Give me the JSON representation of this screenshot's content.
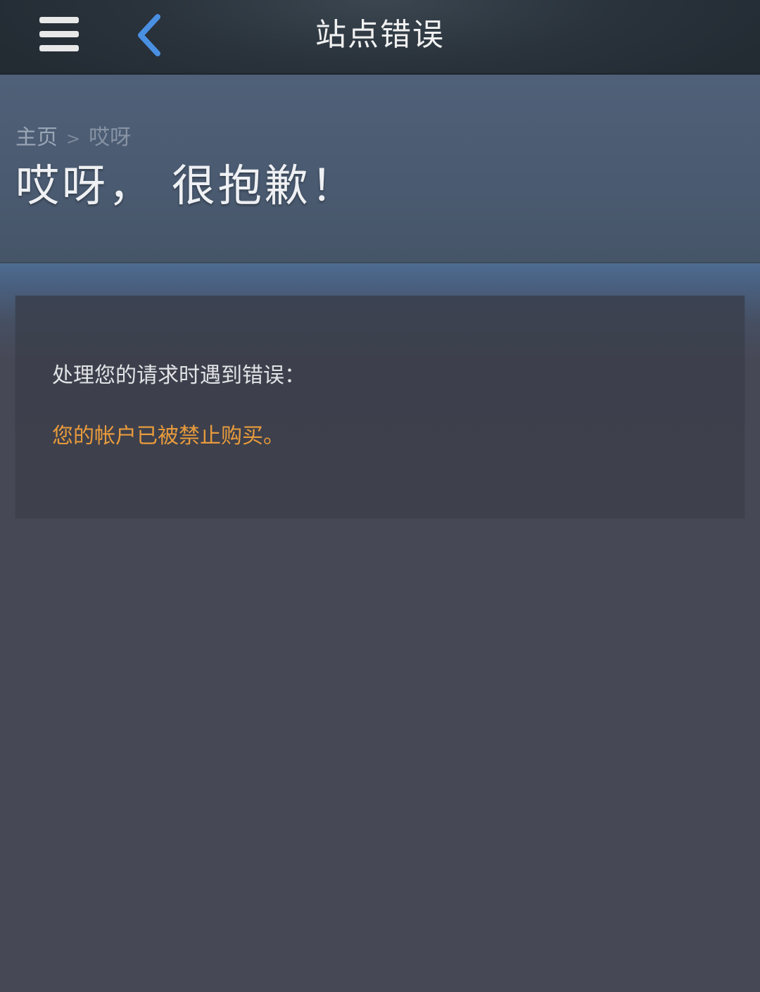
{
  "nav": {
    "title": "站点错误",
    "menu_icon": "hamburger-menu-icon",
    "back_icon": "chevron-left-icon",
    "back_icon_color": "#4a90e2"
  },
  "breadcrumb": {
    "home": "主页",
    "separator": ">",
    "current": "哎呀"
  },
  "heading": "哎呀， 很抱歉！",
  "error": {
    "intro": "处理您的请求时遇到错误：",
    "message": "您的帐户已被禁止购买。",
    "message_color": "#e89b3c"
  }
}
